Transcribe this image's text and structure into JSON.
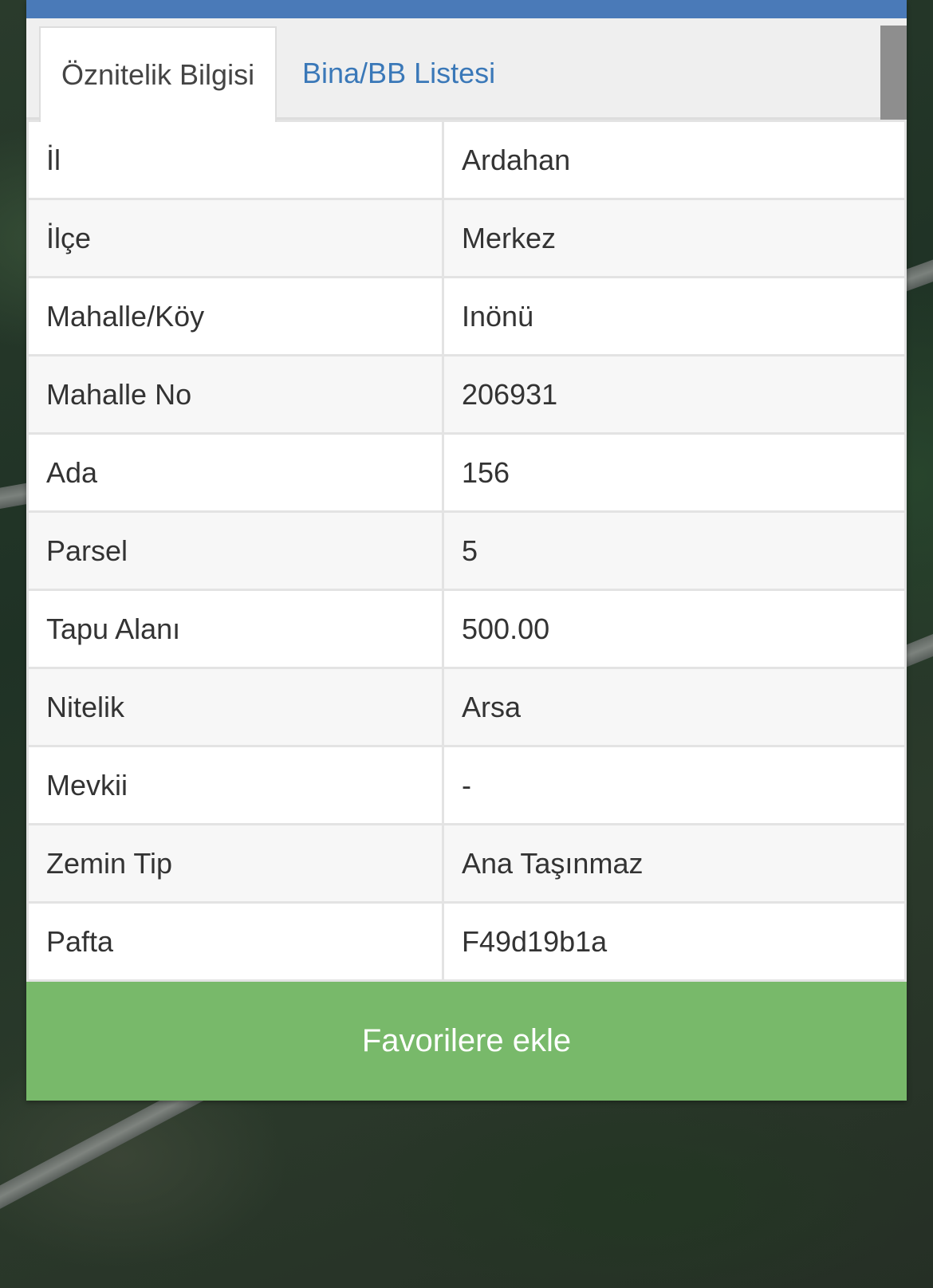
{
  "tabs": [
    {
      "label": "Öznitelik Bilgisi",
      "active": true
    },
    {
      "label": "Bina/BB Listesi",
      "active": false
    }
  ],
  "attributes": [
    {
      "key": "İl",
      "value": "Ardahan"
    },
    {
      "key": "İlçe",
      "value": "Merkez"
    },
    {
      "key": "Mahalle/Köy",
      "value": "Inönü"
    },
    {
      "key": "Mahalle No",
      "value": "206931"
    },
    {
      "key": "Ada",
      "value": "156"
    },
    {
      "key": "Parsel",
      "value": "5"
    },
    {
      "key": "Tapu Alanı",
      "value": "500.00"
    },
    {
      "key": "Nitelik",
      "value": "Arsa"
    },
    {
      "key": "Mevkii",
      "value": "-"
    },
    {
      "key": "Zemin Tip",
      "value": "Ana Taşınmaz"
    },
    {
      "key": "Pafta",
      "value": "F49d19b1a"
    }
  ],
  "actions": {
    "favorite_label": "Favorilere ekle"
  },
  "colors": {
    "topbar": "#4a7ab8",
    "tab_link": "#3a78b8",
    "favorite_button": "#78b96a"
  }
}
